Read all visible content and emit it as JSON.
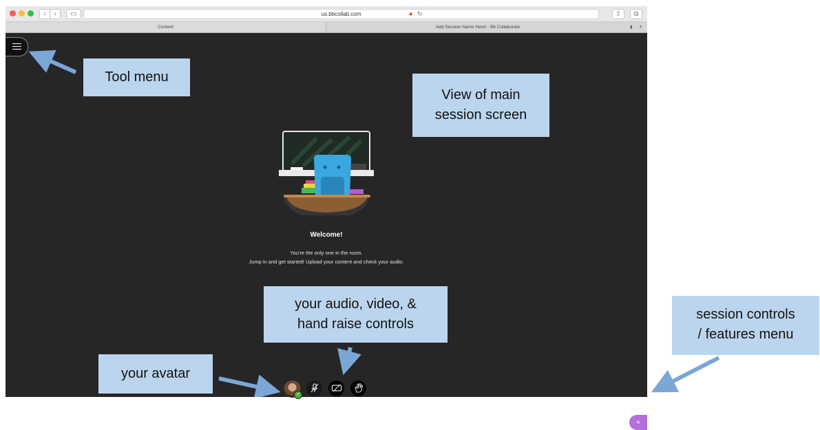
{
  "browser": {
    "url": "us.bbcollab.com",
    "tabs": [
      "Content",
      "Add Session Name Here! - Bb Collaborate"
    ]
  },
  "session": {
    "welcome_title": "Welcome!",
    "welcome_line1": "You're the only one in the room.",
    "welcome_line2": "Jump in and get started! Upload your content and check your audio."
  },
  "annotations": {
    "tool_menu": "Tool menu",
    "main_view": [
      "View of main",
      "session screen"
    ],
    "audio_controls": [
      "your audio, video, &",
      "hand raise controls"
    ],
    "avatar": "your avatar",
    "session_controls": [
      "session controls",
      "/ features menu"
    ]
  },
  "icons": {
    "menu": "hamburger-icon",
    "mic_muted": "mic-muted-icon",
    "camera_off": "camera-off-icon",
    "hand_raise": "hand-raise-icon",
    "collapse": "chevron-left-icon"
  },
  "colors": {
    "session_bg": "#262626",
    "label_bg": "#bcd5ee",
    "arrow": "#7aa7d6",
    "features_button": "#b56fdc"
  }
}
